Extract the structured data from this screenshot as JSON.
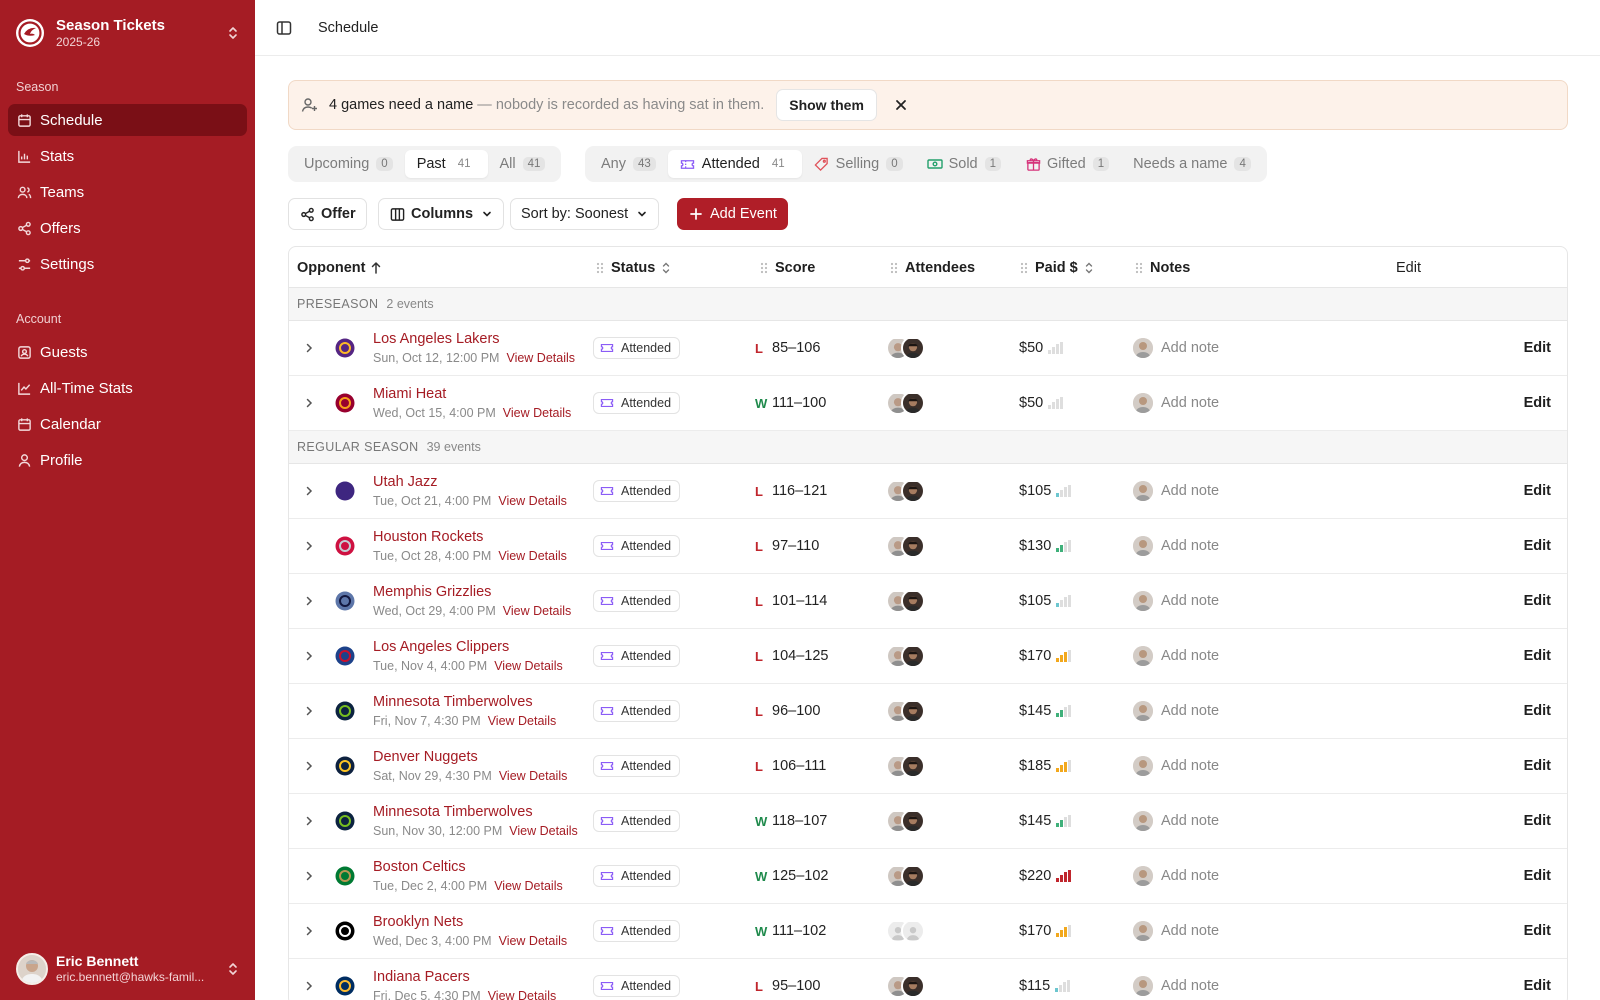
{
  "app": {
    "title": "Season Tickets",
    "season": "2025-26"
  },
  "sidebar": {
    "season_label": "Season",
    "season_items": [
      {
        "label": "Schedule",
        "icon": "calendar-icon",
        "active": true
      },
      {
        "label": "Stats",
        "icon": "bar-chart-icon"
      },
      {
        "label": "Teams",
        "icon": "users-icon"
      },
      {
        "label": "Offers",
        "icon": "share-icon"
      },
      {
        "label": "Settings",
        "icon": "sliders-icon"
      }
    ],
    "account_label": "Account",
    "account_items": [
      {
        "label": "Guests",
        "icon": "contact-card-icon"
      },
      {
        "label": "All-Time Stats",
        "icon": "line-chart-icon"
      },
      {
        "label": "Calendar",
        "icon": "calendar-icon"
      },
      {
        "label": "Profile",
        "icon": "user-icon"
      }
    ],
    "user": {
      "name": "Eric Bennett",
      "email": "eric.bennett@hawks-famil..."
    }
  },
  "topbar": {
    "breadcrumb": "Schedule"
  },
  "banner": {
    "strong": "4 games need a name",
    "muted": "— nobody is recorded as having sat in them.",
    "button": "Show them"
  },
  "time_filter": [
    {
      "label": "Upcoming",
      "count": "0"
    },
    {
      "label": "Past",
      "count": "41",
      "active": true
    },
    {
      "label": "All",
      "count": "41"
    }
  ],
  "status_filter": [
    {
      "label": "Any",
      "count": "43"
    },
    {
      "label": "Attended",
      "count": "41",
      "icon": "ticket-icon",
      "active": true
    },
    {
      "label": "Selling",
      "count": "0",
      "icon": "tag-icon"
    },
    {
      "label": "Sold",
      "count": "1",
      "icon": "cash-icon"
    },
    {
      "label": "Gifted",
      "count": "1",
      "icon": "gift-icon"
    },
    {
      "label": "Needs a name",
      "count": "4"
    }
  ],
  "toolbar": {
    "offer": "Offer",
    "columns": "Columns",
    "sort": "Sort by: Soonest",
    "add": "Add Event"
  },
  "columns": {
    "opponent": "Opponent",
    "status": "Status",
    "score": "Score",
    "attendees": "Attendees",
    "paid": "Paid $",
    "notes": "Notes",
    "edit": "Edit"
  },
  "groups": [
    {
      "name": "PRESEASON",
      "count": "2 events"
    },
    {
      "name": "REGULAR SEASON",
      "count": "39 events"
    }
  ],
  "row_labels": {
    "view_details": "View Details",
    "add_note": "Add note",
    "edit": "Edit"
  },
  "rows": [
    {
      "team": "Los Angeles Lakers",
      "date": "Sun, Oct 12, 12:00 PM",
      "status": "Attended",
      "result": "L",
      "score": "85–106",
      "paid": "$50",
      "price_level": 0,
      "logo_color": "#552583",
      "logo_accent": "#fdb927",
      "attendees": "known"
    },
    {
      "team": "Miami Heat",
      "date": "Wed, Oct 15, 4:00 PM",
      "status": "Attended",
      "result": "W",
      "score": "111–100",
      "paid": "$50",
      "price_level": 0,
      "logo_color": "#98002e",
      "logo_accent": "#f9a01b",
      "attendees": "known"
    },
    {
      "team": "Utah Jazz",
      "date": "Tue, Oct 21, 4:00 PM",
      "status": "Attended",
      "result": "L",
      "score": "116–121",
      "paid": "$105",
      "price_level": 1,
      "logo_color": "#3e2680",
      "logo_accent": "#3e2680",
      "attendees": "known"
    },
    {
      "team": "Houston Rockets",
      "date": "Tue, Oct 28, 4:00 PM",
      "status": "Attended",
      "result": "L",
      "score": "97–110",
      "paid": "$130",
      "price_level": 2,
      "logo_color": "#ce1141",
      "logo_accent": "#c4ced4",
      "attendees": "known"
    },
    {
      "team": "Memphis Grizzlies",
      "date": "Wed, Oct 29, 4:00 PM",
      "status": "Attended",
      "result": "L",
      "score": "101–114",
      "paid": "$105",
      "price_level": 1,
      "logo_color": "#5d76a9",
      "logo_accent": "#12173f",
      "attendees": "known"
    },
    {
      "team": "Los Angeles Clippers",
      "date": "Tue, Nov 4, 4:00 PM",
      "status": "Attended",
      "result": "L",
      "score": "104–125",
      "paid": "$170",
      "price_level": 3,
      "logo_color": "#1d428a",
      "logo_accent": "#c8102e",
      "attendees": "known"
    },
    {
      "team": "Minnesota Timberwolves",
      "date": "Fri, Nov 7, 4:30 PM",
      "status": "Attended",
      "result": "L",
      "score": "96–100",
      "paid": "$145",
      "price_level": 2,
      "logo_color": "#0c2340",
      "logo_accent": "#78be20",
      "attendees": "known"
    },
    {
      "team": "Denver Nuggets",
      "date": "Sat, Nov 29, 4:30 PM",
      "status": "Attended",
      "result": "L",
      "score": "106–111",
      "paid": "$185",
      "price_level": 3,
      "logo_color": "#0e2240",
      "logo_accent": "#fec524",
      "attendees": "known"
    },
    {
      "team": "Minnesota Timberwolves",
      "date": "Sun, Nov 30, 12:00 PM",
      "status": "Attended",
      "result": "W",
      "score": "118–107",
      "paid": "$145",
      "price_level": 2,
      "logo_color": "#0c2340",
      "logo_accent": "#78be20",
      "attendees": "known"
    },
    {
      "team": "Boston Celtics",
      "date": "Tue, Dec 2, 4:00 PM",
      "status": "Attended",
      "result": "W",
      "score": "125–102",
      "paid": "$220",
      "price_level": 4,
      "logo_color": "#007a33",
      "logo_accent": "#ba9653",
      "attendees": "known"
    },
    {
      "team": "Brooklyn Nets",
      "date": "Wed, Dec 3, 4:00 PM",
      "status": "Attended",
      "result": "W",
      "score": "111–102",
      "paid": "$170",
      "price_level": 3,
      "logo_color": "#000000",
      "logo_accent": "#ffffff",
      "attendees": "unknown"
    },
    {
      "team": "Indiana Pacers",
      "date": "Fri, Dec 5, 4:30 PM",
      "status": "Attended",
      "result": "L",
      "score": "95–100",
      "paid": "$115",
      "price_level": 1,
      "logo_color": "#002d62",
      "logo_accent": "#fdbb30",
      "attendees": "known"
    }
  ],
  "colors": {
    "sidebar": "#a51c24",
    "sidebar_active": "#7a0f16",
    "accent": "#b01e28",
    "win": "#1f8a4c",
    "loss": "#c0262d",
    "price_low": "#6cc6cf",
    "price_mid": "#3fb07a",
    "price_high": "#f2a81d",
    "price_top": "#c0262d"
  }
}
